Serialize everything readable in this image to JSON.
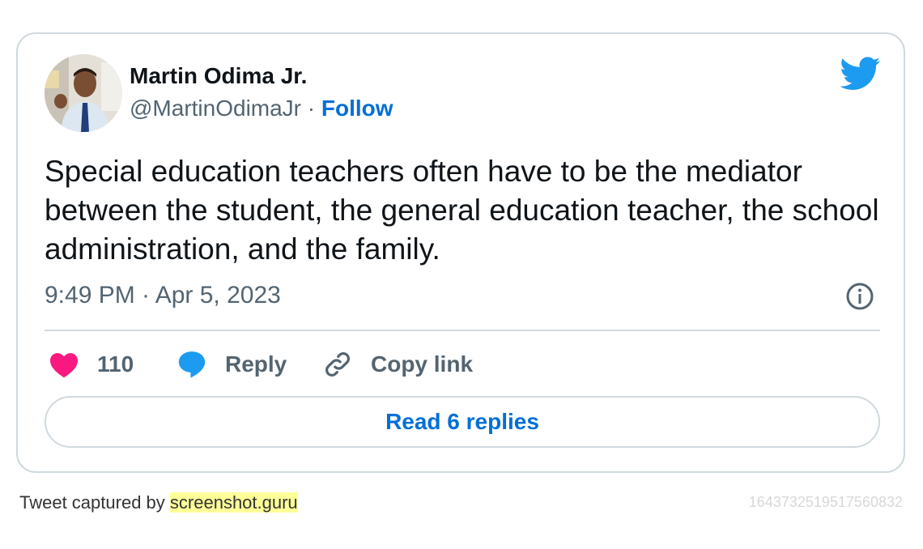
{
  "tweet": {
    "author_name": "Martin Odima Jr.",
    "handle": "@MartinOdimaJr",
    "separator": "·",
    "follow_label": "Follow",
    "text": "Special education teachers often have to be the mediator between the student, the general education teacher, the school administration, and the family.",
    "timestamp": "9:49 PM · Apr 5, 2023",
    "like_count": "110",
    "reply_label": "Reply",
    "copy_link_label": "Copy link",
    "read_replies_label": "Read 6 replies"
  },
  "icons": {
    "brand": "twitter-bird-icon",
    "info": "info-icon",
    "like": "heart-icon",
    "reply": "speech-bubble-icon",
    "copy": "link-icon"
  },
  "colors": {
    "brand_blue": "#1d9bf0",
    "link_blue": "#006fd6",
    "heart_pink": "#f91880",
    "text_primary": "#0f1419",
    "text_secondary": "#536471",
    "border": "#cfd9de",
    "highlight": "#ffff99"
  },
  "footer": {
    "captured_prefix": "Tweet captured by",
    "captured_site": "screenshot.guru",
    "tweet_id": "1643732519517560832"
  }
}
